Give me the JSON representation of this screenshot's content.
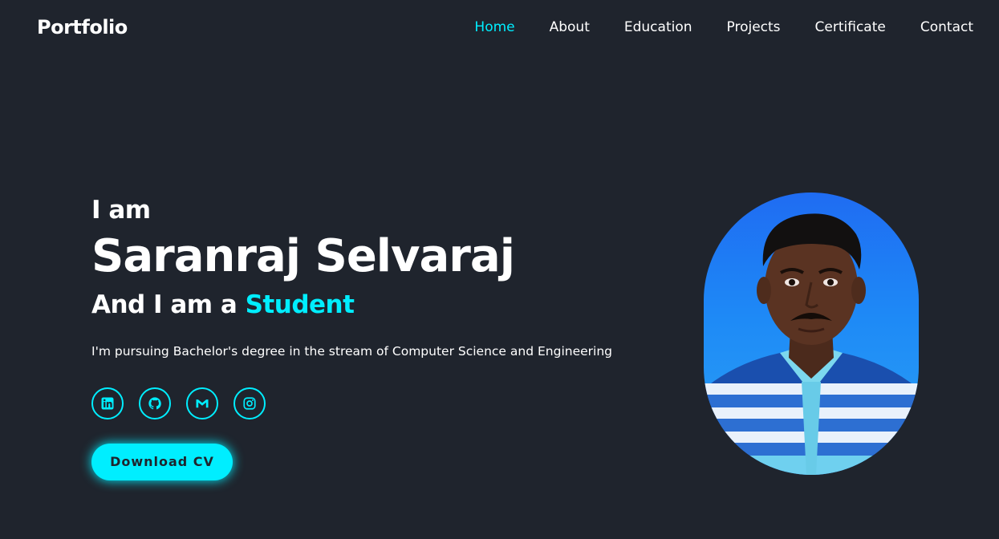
{
  "header": {
    "logo": "Portfolio",
    "nav": [
      {
        "label": "Home",
        "active": true
      },
      {
        "label": "About"
      },
      {
        "label": "Education"
      },
      {
        "label": "Projects"
      },
      {
        "label": "Certificate"
      },
      {
        "label": "Contact"
      }
    ]
  },
  "hero": {
    "intro": "I am",
    "name": "Saranraj Selvaraj",
    "role_prefix": "And I am a ",
    "role_highlight": "Student",
    "description": "I'm pursuing Bachelor's degree in the stream of Computer Science and Engineering",
    "socials": [
      {
        "icon": "linkedin-icon"
      },
      {
        "icon": "github-icon"
      },
      {
        "icon": "gmail-icon"
      },
      {
        "icon": "instagram-icon"
      }
    ],
    "cv_button": "Download CV"
  },
  "colors": {
    "background": "#1f242d",
    "accent": "#00eeff",
    "text": "#ffffff"
  }
}
